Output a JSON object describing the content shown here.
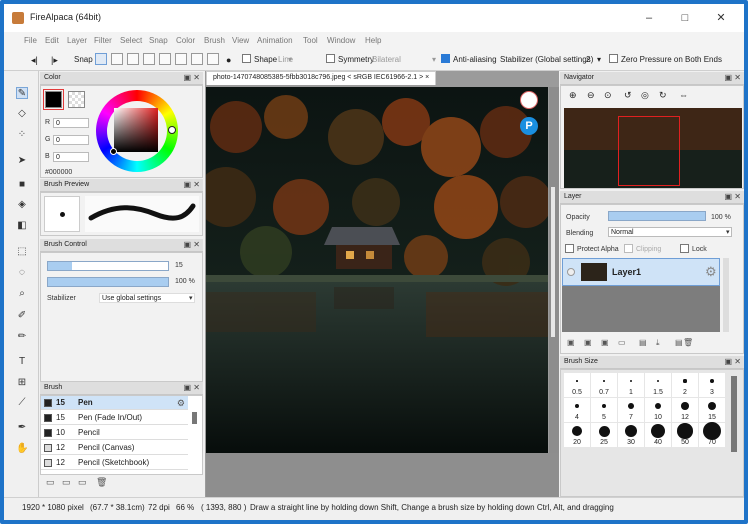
{
  "window": {
    "title": "FireAlpaca (64bit)",
    "controls": [
      "–",
      "□",
      "✕"
    ]
  },
  "menu": [
    "File",
    "Edit",
    "Layer",
    "Filter",
    "Select",
    "Snap",
    "Color",
    "Brush",
    "View",
    "Animation",
    "Tool",
    "Window",
    "Help"
  ],
  "toolbar": {
    "snap_label": "Snap",
    "shape_label": "Shape",
    "shape_value": "Line",
    "symmetry_label": "Symmetry",
    "symmetry_value": "Bilateral",
    "antialias_label": "Anti-aliasing",
    "stabilizer_label": "Stabilizer (Global settings)",
    "stabilizer_value": "2",
    "zero_pressure_label": "Zero Pressure on Both Ends"
  },
  "color_panel": {
    "title": "Color",
    "r_label": "R",
    "r_value": "0",
    "g_label": "G",
    "g_value": "0",
    "b_label": "B",
    "b_value": "0",
    "hex": "#000000",
    "primary": "#000000",
    "accent": "#e23b3b"
  },
  "brush_preview": {
    "title": "Brush Preview"
  },
  "brush_control": {
    "title": "Brush Control",
    "size_value": "15",
    "opacity_value": "100 %",
    "stabilizer_label": "Stabilizer",
    "stabilizer_value": "Use global settings",
    "size_fraction": 0.2,
    "opacity_fraction": 1.0
  },
  "brush_panel": {
    "title": "Brush",
    "items": [
      {
        "size": "15",
        "name": "Pen",
        "selected": true
      },
      {
        "size": "15",
        "name": "Pen (Fade In/Out)",
        "selected": false
      },
      {
        "size": "10",
        "name": "Pencil",
        "selected": false
      },
      {
        "size": "12",
        "name": "Pencil (Canvas)",
        "selected": false
      },
      {
        "size": "12",
        "name": "Pencil (Sketchbook)",
        "selected": false
      }
    ]
  },
  "canvas": {
    "tab_label": "photo-1470748085385-5fbb3018c796.jpeg < sRGB IEC61966-2.1 >"
  },
  "navigator": {
    "title": "Navigator"
  },
  "layer_panel": {
    "title": "Layer",
    "opacity_label": "Opacity",
    "opacity_value": "100 %",
    "blending_label": "Blending",
    "blending_value": "Normal",
    "protect_alpha_label": "Protect Alpha",
    "clipping_label": "Clipping",
    "lock_label": "Lock",
    "layer_name": "Layer1"
  },
  "brush_size_panel": {
    "title": "Brush Size",
    "sizes": [
      "0.5",
      "0.7",
      "1",
      "1.5",
      "2",
      "3",
      "4",
      "5",
      "7",
      "10",
      "12",
      "15",
      "20",
      "25",
      "30",
      "40",
      "50",
      "70"
    ]
  },
  "status": {
    "dimensions": "1920 * 1080 pixel",
    "physical": "(67.7 * 38.1cm)",
    "dpi": "72 dpi",
    "zoom": "66 %",
    "coords": "( 1393, 880 )",
    "hint": "Draw a straight line by holding down Shift, Change a brush size by holding down Ctrl, Alt, and dragging"
  }
}
